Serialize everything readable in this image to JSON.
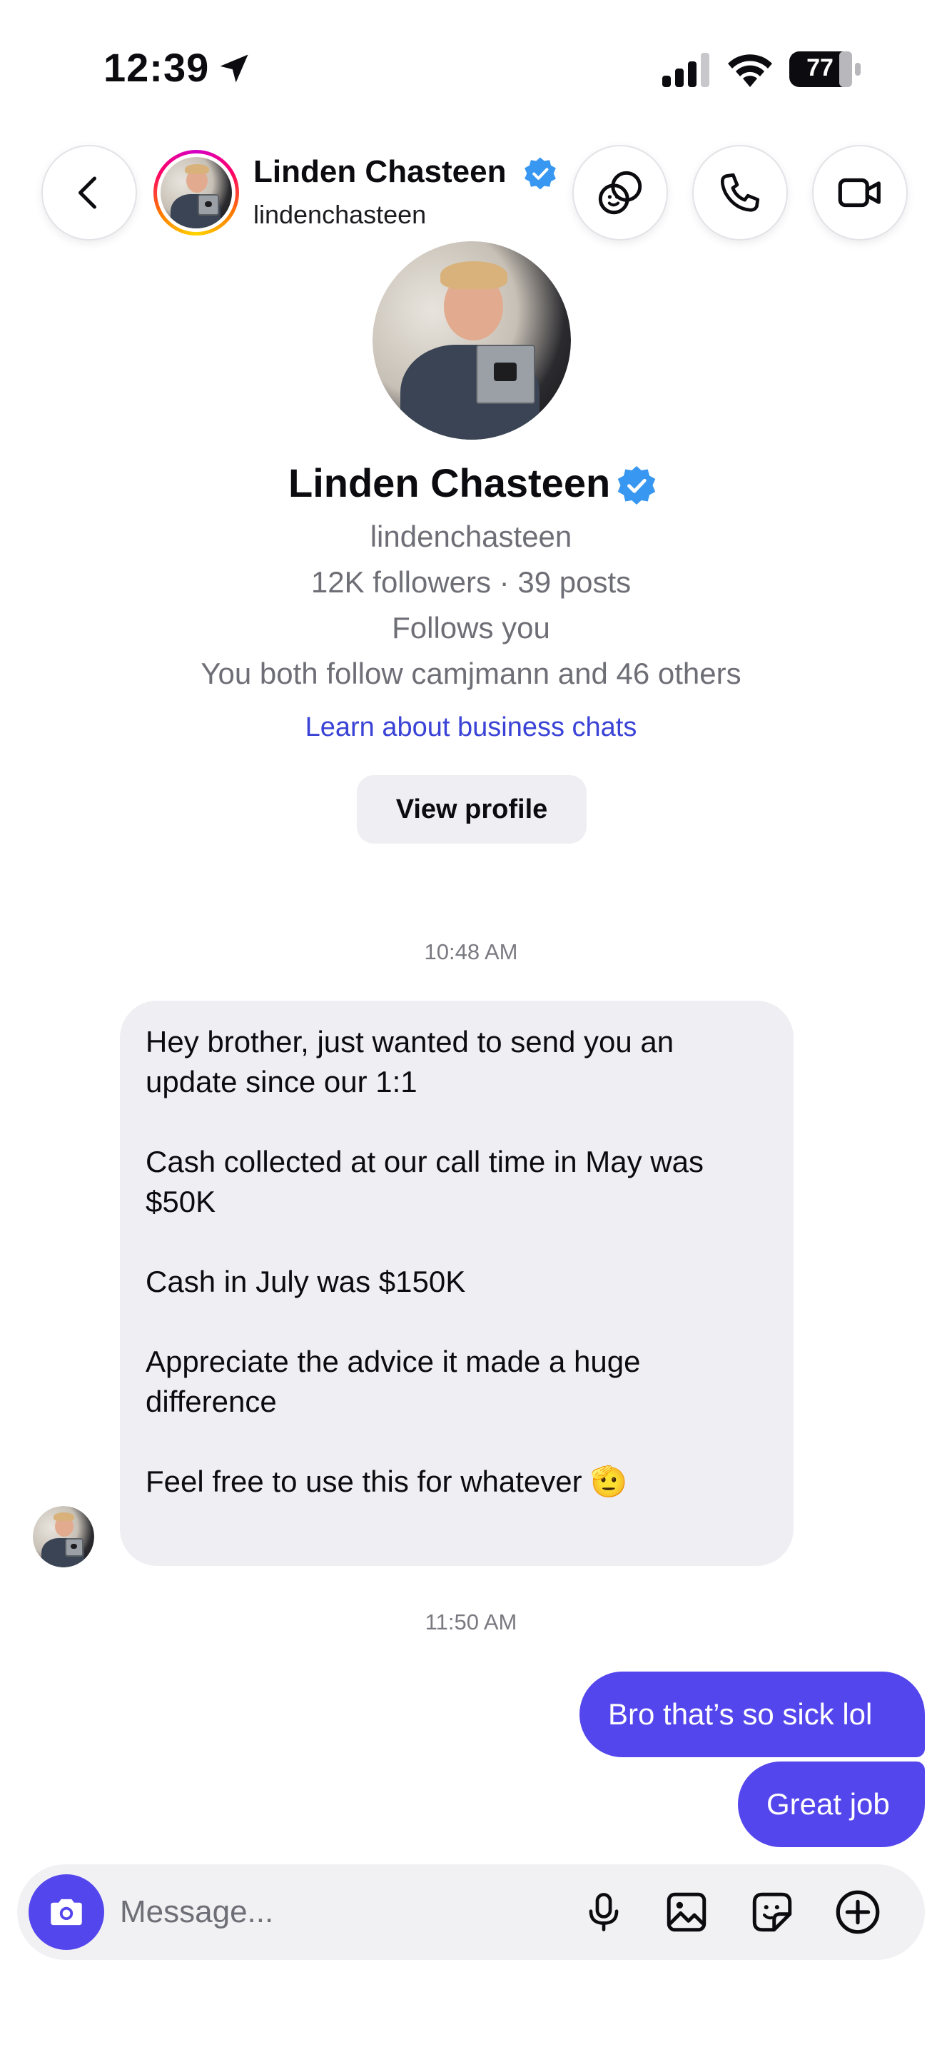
{
  "status_bar": {
    "time": "12:39",
    "battery": "77",
    "location_icon": "location-arrow-icon",
    "signal_icon": "cellular-signal-icon",
    "wifi_icon": "wifi-icon"
  },
  "header": {
    "name": "Linden Chasteen",
    "handle": "lindenchasteen",
    "verified": true,
    "back_icon": "chevron-left-icon",
    "actions": [
      "effects-icon",
      "phone-icon",
      "video-camera-icon"
    ]
  },
  "profile": {
    "name": "Linden Chasteen",
    "handle": "lindenchasteen",
    "stats": "12K followers · 39 posts",
    "follows_you": "Follows you",
    "mutuals": "You both follow camjmann and 46 others",
    "business_link": "Learn about business chats",
    "view_profile_label": "View profile"
  },
  "messages": {
    "timestamp_1": "10:48 AM",
    "incoming": {
      "p1": "Hey brother, just wanted to send you an update since our 1:1",
      "p2": "Cash collected at our call time in May was $50K",
      "p3": "Cash in July was $150K",
      "p4": "Appreciate the advice it made a huge difference",
      "p5": "Feel free to use this for whatever 🫡"
    },
    "timestamp_2": "11:50 AM",
    "outgoing": [
      "Bro that’s so sick lol",
      "Great job"
    ]
  },
  "composer": {
    "placeholder": "Message...",
    "icons": [
      "camera-icon",
      "microphone-icon",
      "gallery-icon",
      "sticker-icon",
      "plus-circle-icon"
    ]
  },
  "colors": {
    "accent": "#5446ed",
    "link": "#3a43d6",
    "verified": "#3897f0",
    "incoming_bubble": "#efeff3"
  }
}
